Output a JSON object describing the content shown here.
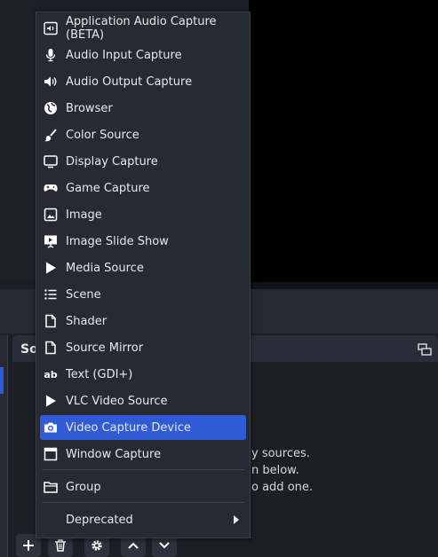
{
  "sources_dock": {
    "title": "So",
    "hint_lines": [
      "y sources.",
      "n below.",
      "o add one."
    ]
  },
  "menu": {
    "items": [
      {
        "label": "Application Audio Capture (BETA)",
        "icon": "app-audio-icon"
      },
      {
        "label": "Audio Input Capture",
        "icon": "microphone-icon"
      },
      {
        "label": "Audio Output Capture",
        "icon": "speaker-icon"
      },
      {
        "label": "Browser",
        "icon": "globe-icon"
      },
      {
        "label": "Color Source",
        "icon": "brush-icon"
      },
      {
        "label": "Display Capture",
        "icon": "monitor-icon"
      },
      {
        "label": "Game Capture",
        "icon": "gamepad-icon"
      },
      {
        "label": "Image",
        "icon": "image-icon"
      },
      {
        "label": "Image Slide Show",
        "icon": "slideshow-icon"
      },
      {
        "label": "Media Source",
        "icon": "play-icon"
      },
      {
        "label": "Scene",
        "icon": "list-icon"
      },
      {
        "label": "Shader",
        "icon": "file-icon"
      },
      {
        "label": "Source Mirror",
        "icon": "file-icon"
      },
      {
        "label": "Text (GDI+)",
        "icon": "text-icon",
        "glyph": "ab"
      },
      {
        "label": "VLC Video Source",
        "icon": "play-icon"
      },
      {
        "label": "Video Capture Device",
        "icon": "camera-icon",
        "selected": true
      },
      {
        "label": "Window Capture",
        "icon": "window-icon"
      }
    ],
    "group_label": "Group",
    "deprecated_label": "Deprecated"
  },
  "toolbar": [
    "add-icon",
    "trash-icon",
    "gear-icon",
    "chevron-up-icon",
    "chevron-down-icon"
  ],
  "colors": {
    "accent": "#2f5cd6",
    "menu_bg": "#272a33",
    "preview_bg": "#000000"
  }
}
